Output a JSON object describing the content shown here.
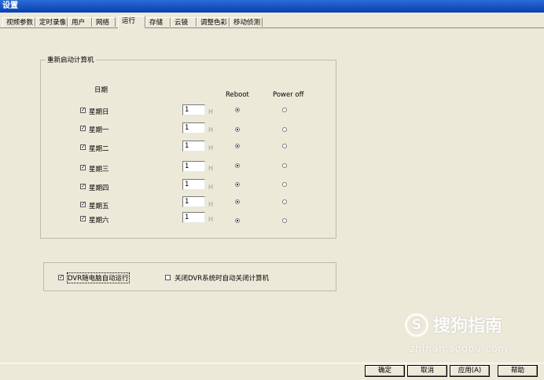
{
  "window": {
    "title": "设置"
  },
  "tabs": [
    {
      "label": "视频参数"
    },
    {
      "label": "定时录像"
    },
    {
      "label": "用户"
    },
    {
      "label": "网络"
    },
    {
      "label": "运行"
    },
    {
      "label": "存储"
    },
    {
      "label": "云镜"
    },
    {
      "label": "调整色彩"
    },
    {
      "label": "移动侦测"
    }
  ],
  "active_tab": "运行",
  "restart_group": {
    "title": "重新启动计算机",
    "col_day": "日期",
    "col_reboot": "Reboot",
    "col_poweroff": "Power off",
    "unit": "H",
    "days": [
      {
        "label": "星期日",
        "checked": true,
        "hour": "1",
        "action": "reboot"
      },
      {
        "label": "星期一",
        "checked": true,
        "hour": "1",
        "action": "reboot"
      },
      {
        "label": "星期二",
        "checked": true,
        "hour": "1",
        "action": "reboot"
      },
      {
        "label": "星期三",
        "checked": true,
        "hour": "1",
        "action": "reboot"
      },
      {
        "label": "星期四",
        "checked": true,
        "hour": "1",
        "action": "reboot"
      },
      {
        "label": "星期五",
        "checked": true,
        "hour": "1",
        "action": "reboot"
      },
      {
        "label": "星期六",
        "checked": true,
        "hour": "1",
        "action": "reboot"
      }
    ]
  },
  "options": {
    "autostart": {
      "label": "DVR随电脑自动运行",
      "checked": true
    },
    "shutdown": {
      "label": "关闭DVR系统时自动关闭计算机",
      "checked": false
    }
  },
  "watermark": {
    "icon": "sogou-s-icon",
    "glyph": "S",
    "text": "搜狗指南",
    "url": "zhinan.sogou.com"
  },
  "buttons": {
    "ok": "确定",
    "cancel": "取消",
    "apply": "应用(A)",
    "help": "帮助"
  },
  "colors": {
    "window_bg": "#ece9d8",
    "titlebar": "#0a3fb0"
  }
}
